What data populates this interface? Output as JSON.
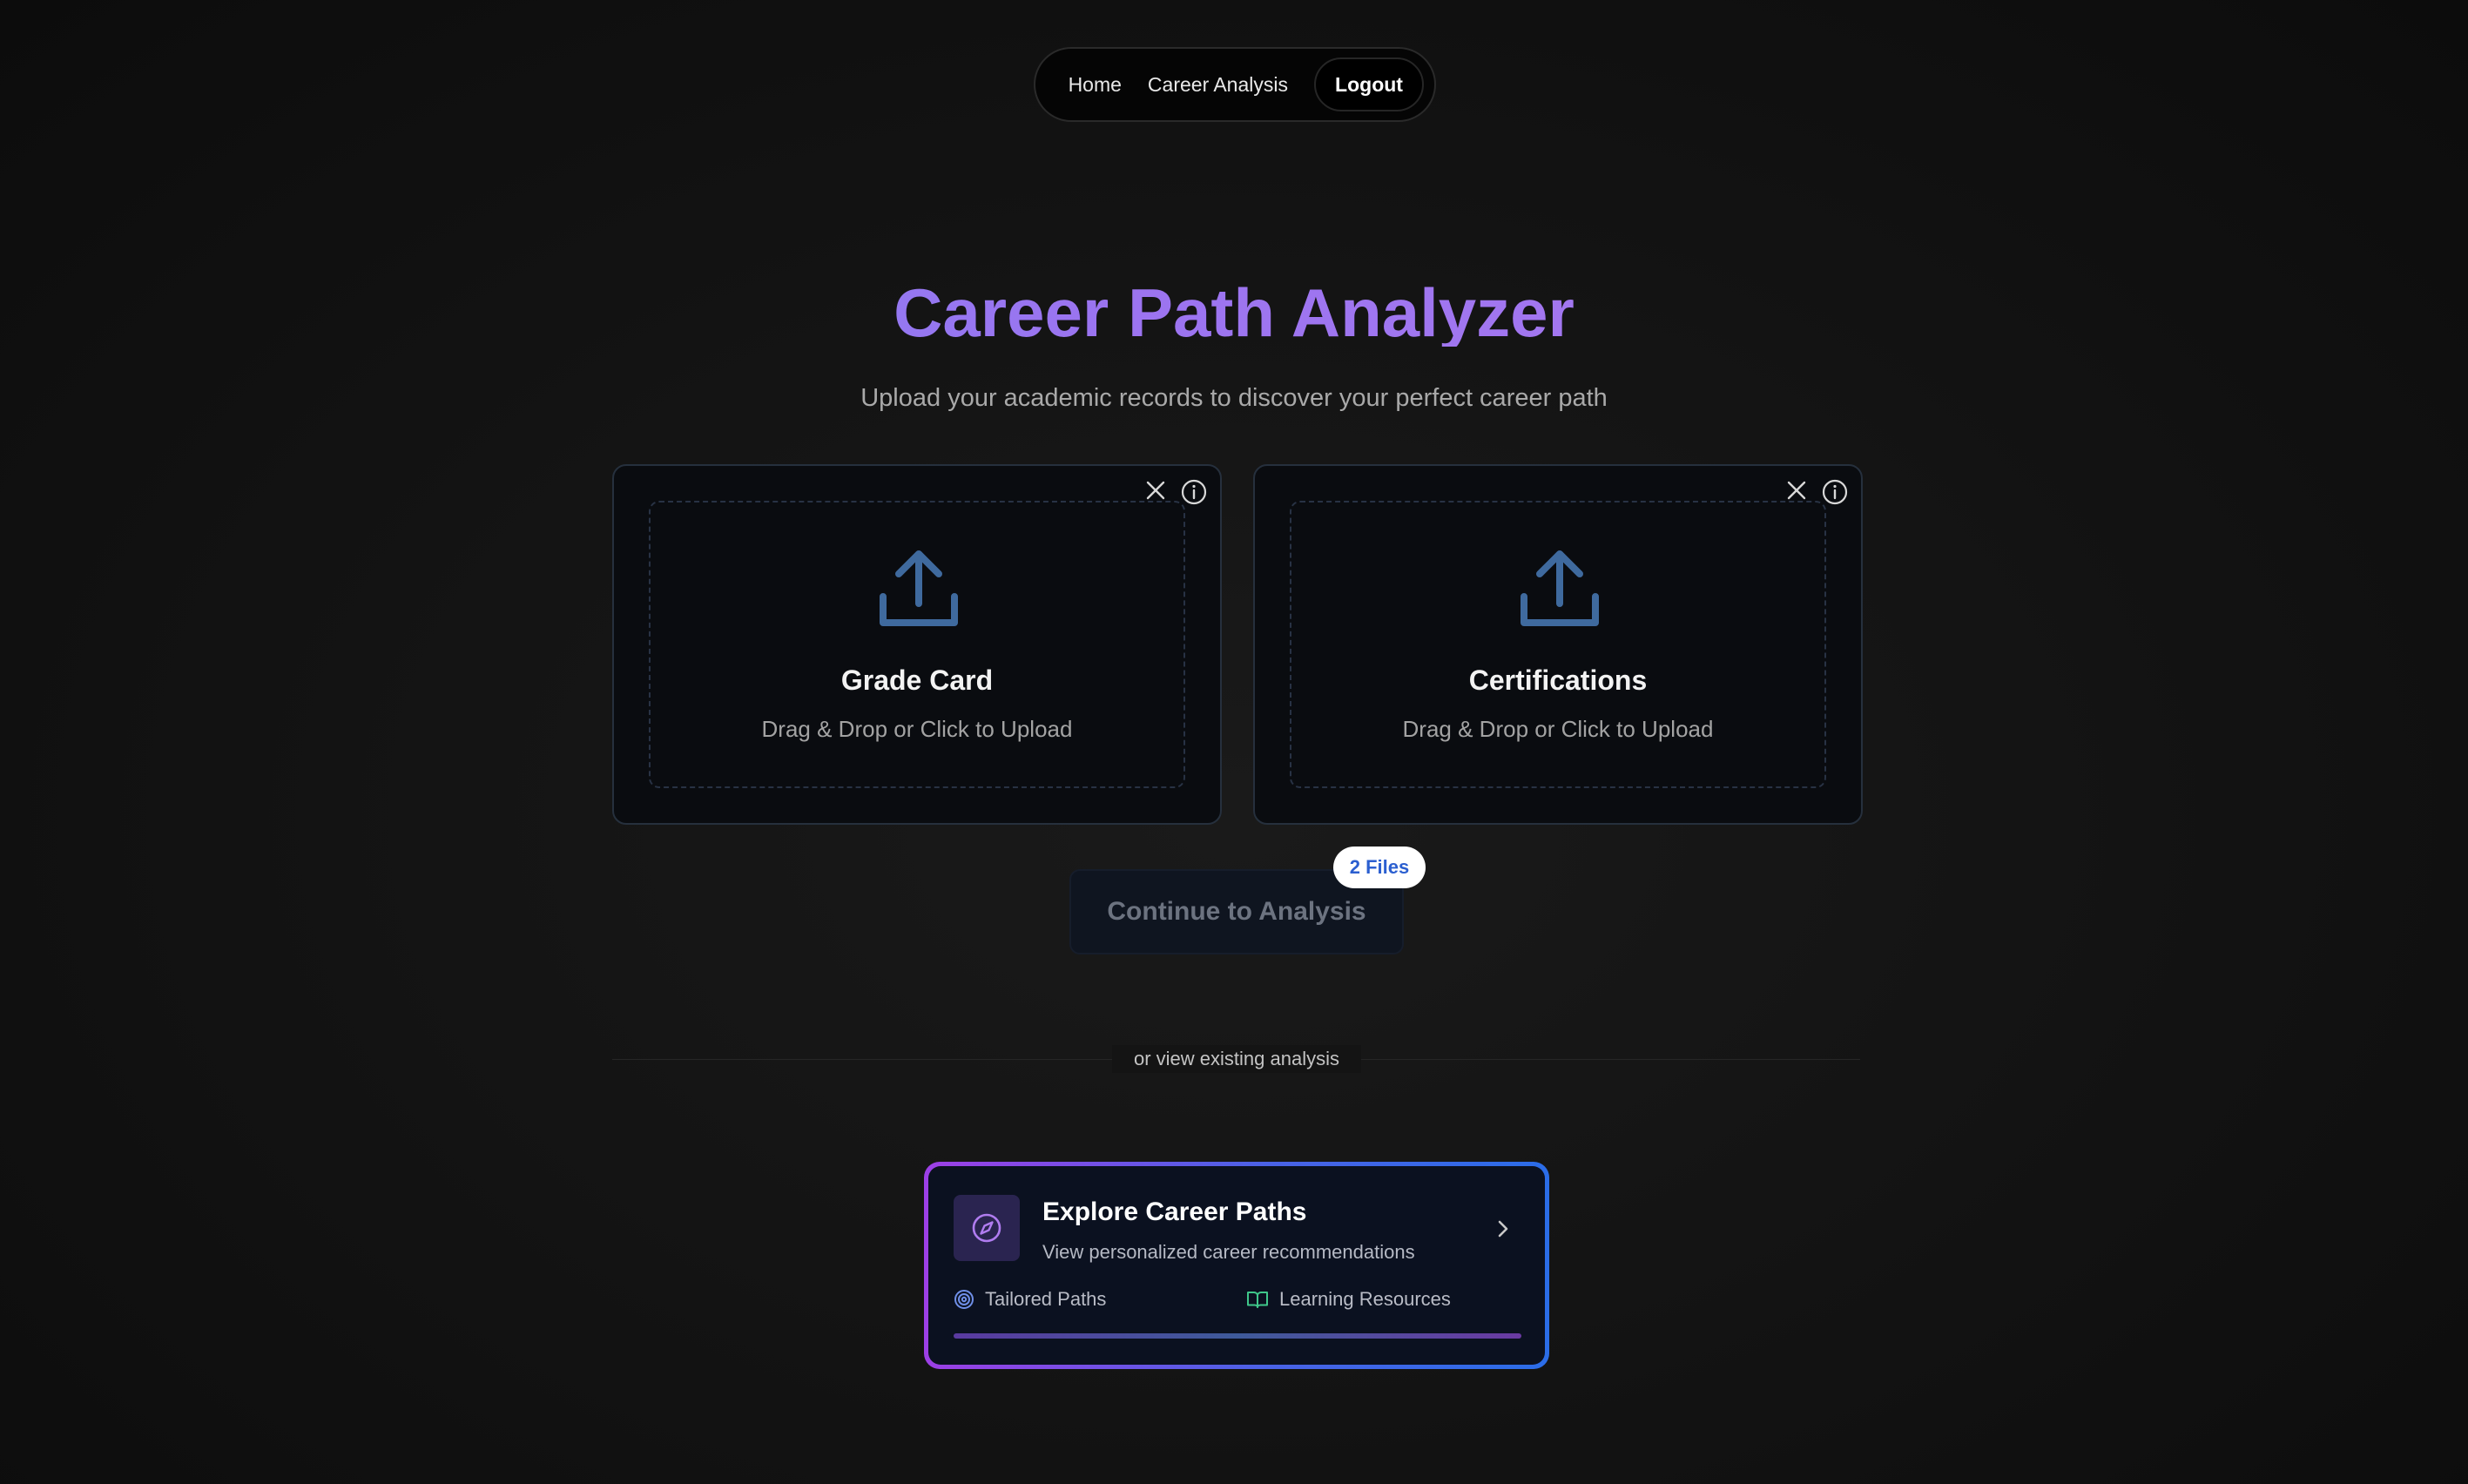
{
  "nav": {
    "home": "Home",
    "career_analysis": "Career Analysis",
    "logout": "Logout"
  },
  "hero": {
    "title": "Career Path Analyzer",
    "subtitle": "Upload your academic records to discover your perfect career path"
  },
  "uploads": [
    {
      "title": "Grade Card",
      "hint": "Drag & Drop or Click to Upload",
      "icon": "upload-icon"
    },
    {
      "title": "Certifications",
      "hint": "Drag & Drop or Click to Upload",
      "icon": "upload-icon"
    }
  ],
  "continue": {
    "label": "Continue to Analysis",
    "badge": "2 Files"
  },
  "divider": {
    "text": "or view existing analysis"
  },
  "explore": {
    "title": "Explore Career Paths",
    "subtitle": "View personalized career recommendations",
    "features": [
      {
        "label": "Tailored Paths",
        "icon": "target-icon"
      },
      {
        "label": "Learning Resources",
        "icon": "book-icon"
      }
    ]
  },
  "colors": {
    "accent_purple": "#9b74f0",
    "accent_blue": "#2b6de8",
    "upload_icon": "#3f6a9e",
    "badge_text": "#2b5fd0"
  }
}
